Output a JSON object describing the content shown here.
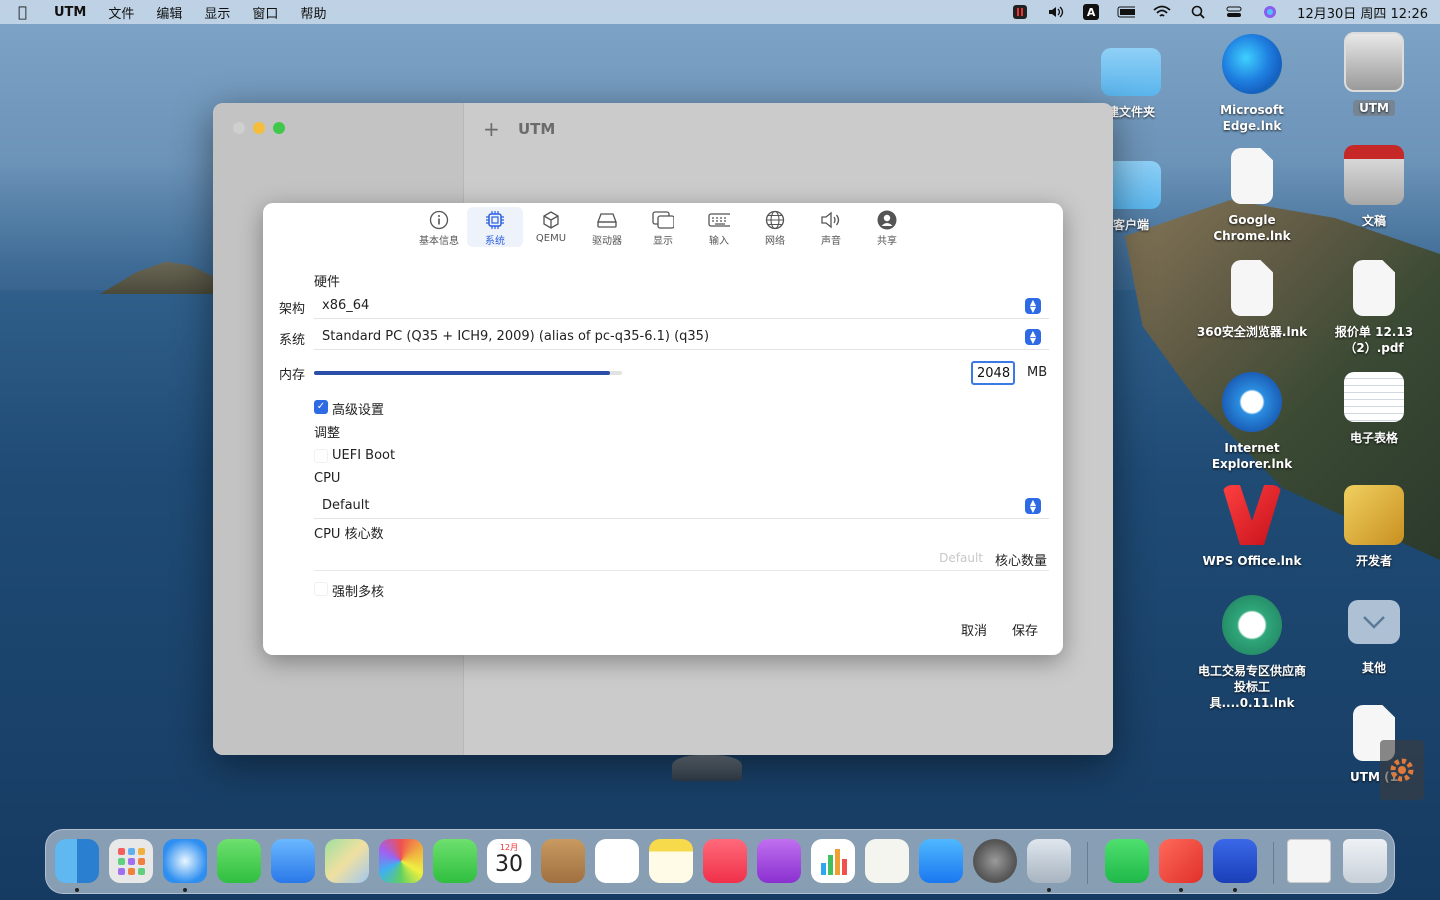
{
  "menubar": {
    "app_name": "UTM",
    "items": [
      "文件",
      "编辑",
      "显示",
      "窗口",
      "帮助"
    ],
    "clock": "12月30日 周四 12:26",
    "input_source": "A"
  },
  "desktop_icons": [
    {
      "label": "建文件夹",
      "type": "folder"
    },
    {
      "label": "Microsoft Edge.lnk",
      "type": "edge"
    },
    {
      "label": "UTM",
      "type": "drive"
    },
    {
      "label": "客户端",
      "type": "folder"
    },
    {
      "label": "Google\nChrome.lnk",
      "type": "doc"
    },
    {
      "label": "文稿",
      "type": "parallels"
    },
    {
      "label": "360安全浏览器.lnk",
      "type": "doc"
    },
    {
      "label": "报价单 12.13\n（2）.pdf",
      "type": "pdf"
    },
    {
      "label": "Internet\nExplorer.lnk",
      "type": "ie"
    },
    {
      "label": "电子表格",
      "type": "sheet"
    },
    {
      "label": "WPS Office.lnk",
      "type": "wps"
    },
    {
      "label": "开发者",
      "type": "dev"
    },
    {
      "label": "电工交易专区供应商\n投标工具....0.11.lnk",
      "type": "app"
    },
    {
      "label": "其他",
      "type": "stack"
    },
    {
      "label": "UTM (1",
      "type": "doc"
    }
  ],
  "window": {
    "title": "UTM",
    "colors": {
      "close": "#cfcfcf",
      "minimize": "#f5bd3c",
      "zoom": "#3fc84c"
    }
  },
  "tabs": [
    {
      "label": "基本信息",
      "icon": "info-icon",
      "active": false
    },
    {
      "label": "系统",
      "icon": "chip-icon",
      "active": true
    },
    {
      "label": "QEMU",
      "icon": "cube-icon",
      "active": false
    },
    {
      "label": "驱动器",
      "icon": "drive-icon",
      "active": false
    },
    {
      "label": "显示",
      "icon": "display-icon",
      "active": false
    },
    {
      "label": "输入",
      "icon": "keyboard-icon",
      "active": false
    },
    {
      "label": "网络",
      "icon": "globe-icon",
      "active": false
    },
    {
      "label": "声音",
      "icon": "speaker-icon",
      "active": false
    },
    {
      "label": "共享",
      "icon": "person-icon",
      "active": false
    }
  ],
  "system": {
    "hardware_heading": "硬件",
    "arch_label": "架构",
    "arch_value": "x86_64",
    "system_label": "系统",
    "system_value": "Standard PC (Q35 + ICH9, 2009) (alias of pc-q35-6.1) (q35)",
    "memory_label": "内存",
    "memory_value": "2048",
    "memory_unit": "MB",
    "memory_fraction": 0.96,
    "advanced_label": "高级设置",
    "advanced_checked": true,
    "tweaks_heading": "调整",
    "uefi_label": "UEFI Boot",
    "uefi_checked": false,
    "cpu_heading": "CPU",
    "cpu_value": "Default",
    "cores_heading": "CPU 核心数",
    "cores_placeholder": "Default",
    "cores_unit": "核心数量",
    "force_multicore_label": "强制多核",
    "force_multicore_checked": false,
    "cancel_label": "取消",
    "save_label": "保存"
  },
  "accent_color": "#2f6ae5"
}
